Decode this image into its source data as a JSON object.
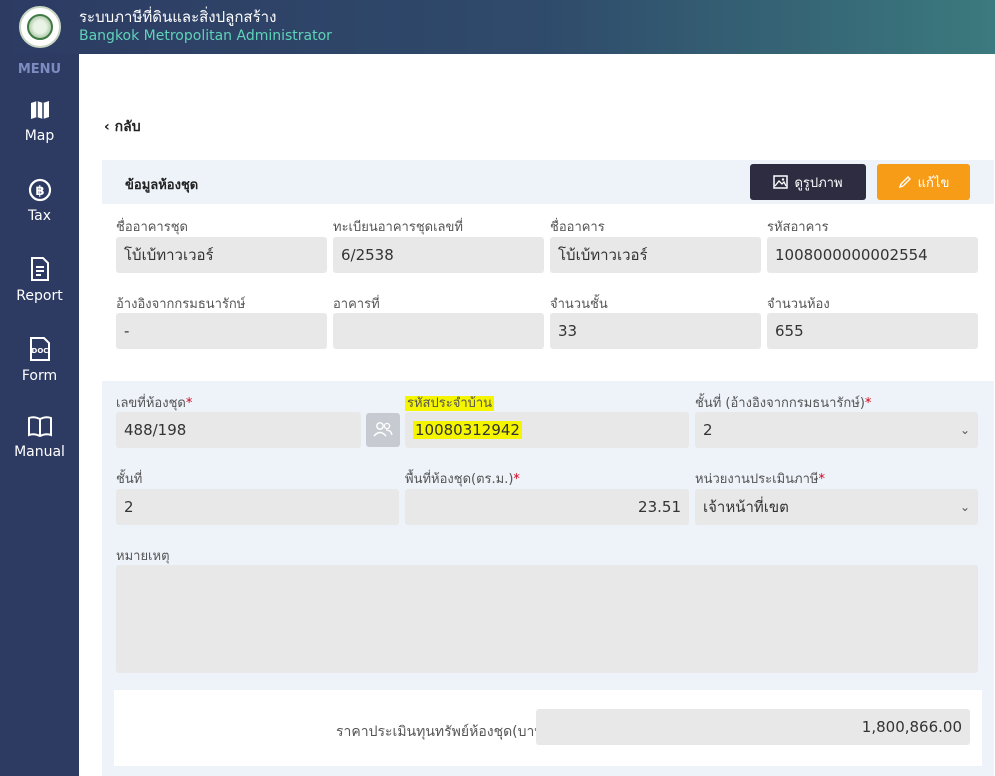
{
  "header": {
    "title": "ระบบภาษีที่ดินและสิ่งปลูกสร้าง",
    "subtitle": "Bangkok Metropolitan Administrator"
  },
  "sidebar": {
    "menu_label": "MENU",
    "items": [
      {
        "label": "Map",
        "icon": "map-icon"
      },
      {
        "label": "Tax",
        "icon": "baht-coin-icon"
      },
      {
        "label": "Report",
        "icon": "report-document-icon"
      },
      {
        "label": "Form",
        "icon": "doc-file-icon"
      },
      {
        "label": "Manual",
        "icon": "book-icon"
      }
    ]
  },
  "back_label": "กลับ",
  "card": {
    "title": "ข้อมูลห้องชุด",
    "view_button": "ดูรูปภาพ",
    "edit_button": "แก้ไข",
    "row1": [
      {
        "label": "ชื่ออาคารชุด",
        "value": "โบ้เบ้ทาวเวอร์"
      },
      {
        "label": "ทะเบียนอาคารชุดเลขที่",
        "value": "6/2538"
      },
      {
        "label": "ชื่ออาคาร",
        "value": "โบ้เบ้ทาวเวอร์"
      },
      {
        "label": "รหัสอาคาร",
        "value": "1008000000002554"
      }
    ],
    "row2": [
      {
        "label": "อ้างอิงจากกรมธนารักษ์",
        "value": "-"
      },
      {
        "label": "อาคารที่",
        "value": ""
      },
      {
        "label": "จำนวนชั้น",
        "value": "33"
      },
      {
        "label": "จำนวนห้อง",
        "value": "655"
      }
    ]
  },
  "unit": {
    "room_no_label": "เลขที่ห้องชุด",
    "room_no_value": "488/198",
    "house_code_label": "รหัสประจำบ้าน",
    "house_code_value": "10080312942",
    "floor_ref_label": "ชั้นที่ (อ้างอิงจากกรมธนารักษ์)",
    "floor_ref_value": "2",
    "floor_label": "ชั้นที่",
    "floor_value": "2",
    "area_label": "พื้นที่ห้องชุด(ตร.ม.)",
    "area_value": "23.51",
    "agency_label": "หน่วยงานประเมินภาษี",
    "agency_value": "เจ้าหน้าที่เขต",
    "remark_label": "หมายเหตุ",
    "remark_value": "",
    "appraisal_label": "ราคาประเมินทุนทรัพย์ห้องชุด(บาท)",
    "appraisal_value": "1,800,866.00",
    "required_mark": "*"
  },
  "colors": {
    "sidebar": "#2d3b63",
    "accent_orange": "#f79c16",
    "dark_button": "#2d2c40",
    "highlight": "#f5f500"
  }
}
